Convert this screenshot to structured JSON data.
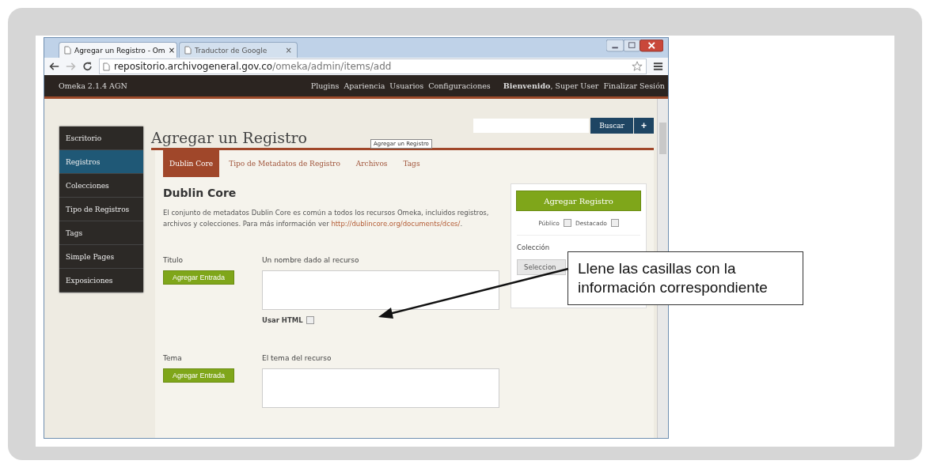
{
  "browser": {
    "tabs": [
      {
        "title": "Agregar un Registro - Om",
        "close": "×",
        "selected": true
      },
      {
        "title": "Traductor de Google",
        "close": "×",
        "selected": false
      }
    ],
    "url": {
      "host": "repositorio.archivogeneral.gov.co",
      "path": "/omeka/admin/items/add"
    }
  },
  "site_header": {
    "brand": "Omeka 2.1.4 AGN",
    "nav": [
      "Plugins",
      "Apariencia",
      "Usuarios",
      "Configuraciones"
    ],
    "welcome": "**Bienvenido**, Super User",
    "logout": "Finalizar Sesión"
  },
  "sidebar": {
    "items": [
      {
        "label": "Escritorio",
        "selected": false
      },
      {
        "label": "Registros",
        "selected": true
      },
      {
        "label": "Colecciones",
        "selected": false
      },
      {
        "label": "Tipo de Registros",
        "selected": false
      },
      {
        "label": "Tags",
        "selected": false
      },
      {
        "label": "Simple Pages",
        "selected": false
      },
      {
        "label": "Exposiciones",
        "selected": false
      }
    ]
  },
  "page": {
    "title": "Agregar un Registro",
    "tooltip": "Agregar un Registro",
    "search_button": "Buscar",
    "add_button": "+",
    "tabs": [
      {
        "label": "Dublin Core",
        "selected": true
      },
      {
        "label": "Tipo de Metadatos de Registro",
        "selected": false
      },
      {
        "label": "Archivos",
        "selected": false
      },
      {
        "label": "Tags",
        "selected": false
      }
    ],
    "section_title": "Dublin Core",
    "description": "El conjunto de metadatos Dublin Core es común a todos los recursos Omeka, incluidos registros, archivos y colecciones. Para más información ver",
    "link": "http://dublincore.org/documents/dces/",
    "link_end": ".",
    "fields": [
      {
        "label": "Titulo",
        "button": "Agregar Entrada",
        "hint": "Un nombre dado al recurso",
        "html_label": "Usar HTML",
        "html_checked": false
      },
      {
        "label": "Tema",
        "button": "Agregar Entrada",
        "hint": "El tema del recurso"
      }
    ],
    "panel": {
      "submit": "Agregar Registro",
      "checkboxes": [
        {
          "label": "Público",
          "checked": false
        },
        {
          "label": "Destacado",
          "checked": false
        }
      ],
      "collection_label": "Colección",
      "collection_select": "Seleccion"
    }
  },
  "callout": {
    "text": "Llene las casillas con la información correspondiente"
  }
}
